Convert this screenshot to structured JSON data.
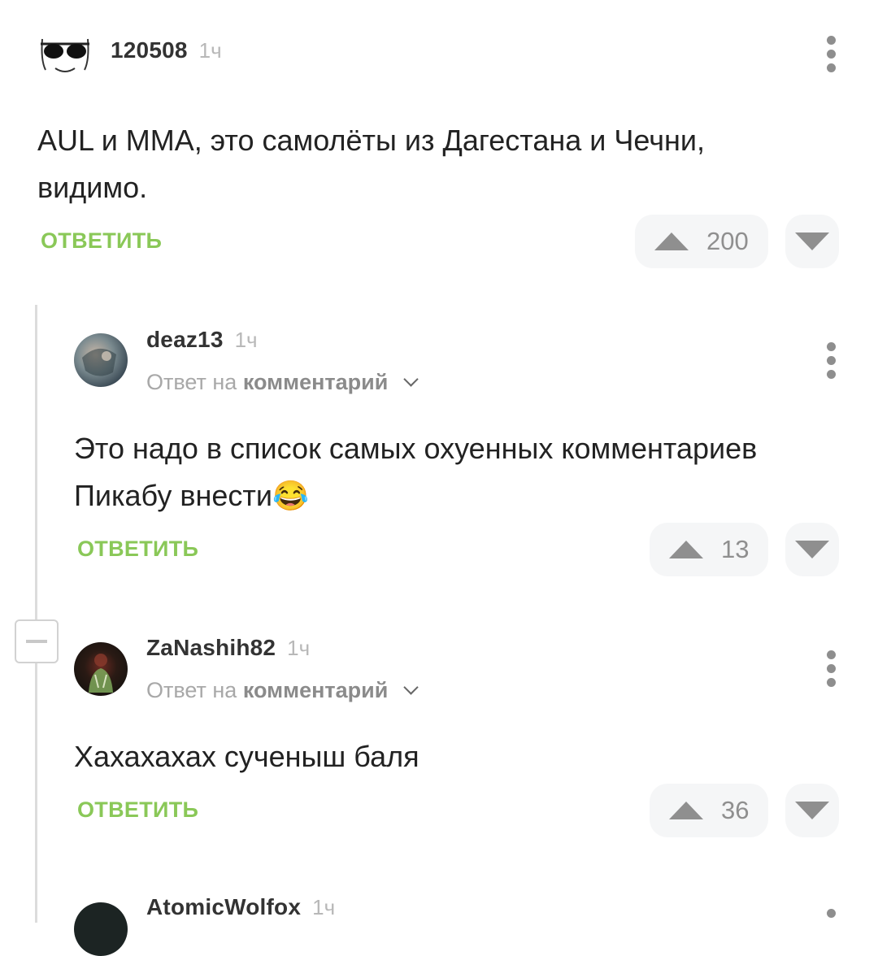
{
  "comments": [
    {
      "username": "120508",
      "time": "1ч",
      "text": "AUL и MMA, это самолёты из Дагестана и Чечни, видимо.",
      "reply_label": "ОТВЕТИТЬ",
      "score": "200"
    },
    {
      "username": "deaz13",
      "time": "1ч",
      "reply_to_prefix": "Ответ на",
      "reply_to_link": "комментарий",
      "text": "Это надо в список самых охуенных комментариев Пикабу внести😂",
      "reply_label": "ОТВЕТИТЬ",
      "score": "13"
    },
    {
      "username": "ZaNashih82",
      "time": "1ч",
      "reply_to_prefix": "Ответ на",
      "reply_to_link": "комментарий",
      "text": "Хахахахах сученыш баля",
      "reply_label": "ОТВЕТИТЬ",
      "score": "36"
    },
    {
      "username": "AtomicWolfox",
      "time": "1ч"
    }
  ],
  "icons": {
    "upvote": "triangle-up-icon",
    "downvote": "triangle-down-icon",
    "menu": "kebab-menu-icon",
    "collapse": "minus-icon",
    "expand_reply": "chevron-down-icon"
  },
  "colors": {
    "reply_button": "#8ac858",
    "vote_background": "#f5f6f7",
    "vote_icon": "#8f8f8f",
    "thread_line": "#dcdcdc"
  }
}
